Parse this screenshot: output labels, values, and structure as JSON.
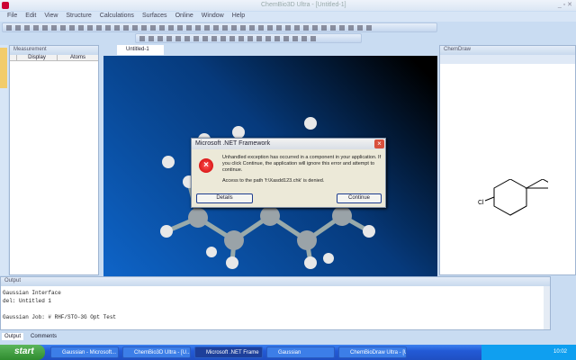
{
  "app": {
    "title": "ChemBio3D Ultra - [Untitled-1]"
  },
  "menu": [
    "File",
    "Edit",
    "View",
    "Structure",
    "Calculations",
    "Surfaces",
    "Online",
    "Window",
    "Help"
  ],
  "left_panel": {
    "title": "Measurement",
    "columns": [
      "Display",
      "Atoms"
    ]
  },
  "doc_tab": "Untitled-1",
  "right_panel": {
    "title": "ChemDraw",
    "label": "Cl"
  },
  "output": {
    "title": "Output",
    "lines": [
      "Gaussian Interface",
      "del: Untitled 1",
      "",
      "Gaussian Job: # RHF/STO-3G Opt Test"
    ],
    "tabs": [
      "Output",
      "Comments"
    ]
  },
  "dialog": {
    "title": "Microsoft .NET Framework",
    "message": "Unhandled exception has occurred in a component in your application. If you click Continue, the application will ignore this error and attempt to continue.",
    "detail": "Access to the path 'f:\\Xasdd123.chk' is denied.",
    "details_button": "Details",
    "continue_button": "Continue"
  },
  "taskbar": {
    "start": "start",
    "tasks": [
      "Gaussian - Microsoft...",
      "ChemBio3D Ultra - [U...",
      "Microsoft .NET Frame",
      "Gaussian",
      "ChemBioDraw Ultra - [Unt..."
    ],
    "clock": "10:02"
  }
}
